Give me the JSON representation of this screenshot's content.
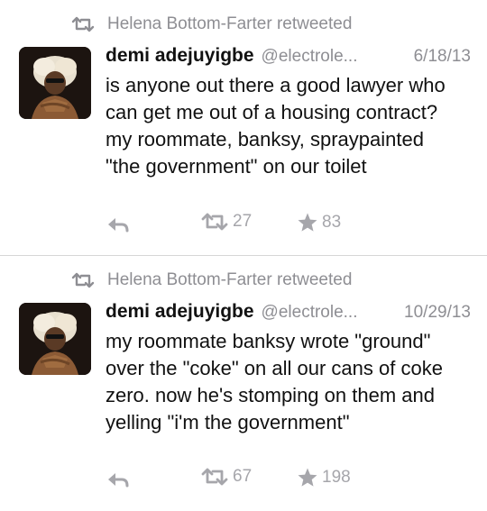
{
  "tweets": [
    {
      "retweet_notice": "Helena Bottom-Farter retweeted",
      "author_name": "demi adejuyigbe",
      "author_handle": "@electrole...",
      "date": "6/18/13",
      "text": "is anyone out there a good lawyer who can get me out of a housing contract? my roommate, banksy, spraypainted \"the government\" on our toilet",
      "retweet_count": "27",
      "favorite_count": "83"
    },
    {
      "retweet_notice": "Helena Bottom-Farter retweeted",
      "author_name": "demi adejuyigbe",
      "author_handle": "@electrole...",
      "date": "10/29/13",
      "text": "my roommate banksy wrote \"ground\" over the \"coke\" on all our cans of coke zero. now he's stomping on them and yelling \"i'm the government\"",
      "retweet_count": "67",
      "favorite_count": "198"
    }
  ],
  "icons": {
    "retweet": "retweet-icon",
    "reply": "reply-icon",
    "favorite": "star-icon"
  },
  "colors": {
    "meta_gray": "#8e8e93",
    "action_gray": "#a6a6ab",
    "text": "#111111",
    "divider": "#d6d6d6"
  }
}
